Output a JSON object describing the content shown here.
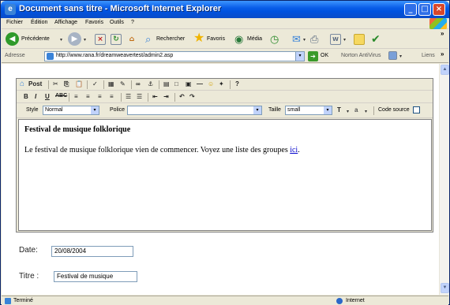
{
  "window": {
    "title": "Document sans titre - Microsoft Internet Explorer",
    "colors": {
      "titlebar": "#0a5ee8",
      "close": "#d8472b"
    }
  },
  "menu": {
    "items": [
      "Fichier",
      "Édition",
      "Affichage",
      "Favoris",
      "Outils",
      "?"
    ]
  },
  "toolbar": {
    "back_label": "Précédente",
    "search_label": "Rechercher",
    "favorites_label": "Favoris",
    "media_label": "Média"
  },
  "address": {
    "label": "Adresse",
    "url": "http://www.rana.fr/dreamweavertest/admin2.asp",
    "go_label": "OK",
    "norton_label": "Norton AntiVirus",
    "links_label": "Liens"
  },
  "editor": {
    "post_label": "Post",
    "style_label": "Style",
    "style_value": "Normal",
    "font_label": "Police",
    "font_value": "",
    "size_label": "Taille",
    "size_value": "small",
    "source_label": "Code source",
    "heading": "Festival de musique folklorique",
    "paragraph": "Le festival de musique folklorique vien de commencer. Voyez une liste des groupes ",
    "link_text": "ici",
    "paragraph_end": "."
  },
  "form": {
    "date_label": "Date:",
    "date_value": "20/08/2004",
    "title_label": "Titre :",
    "title_value": "Festival de musique"
  },
  "status": {
    "left": "Terminé",
    "zone": "Internet"
  }
}
